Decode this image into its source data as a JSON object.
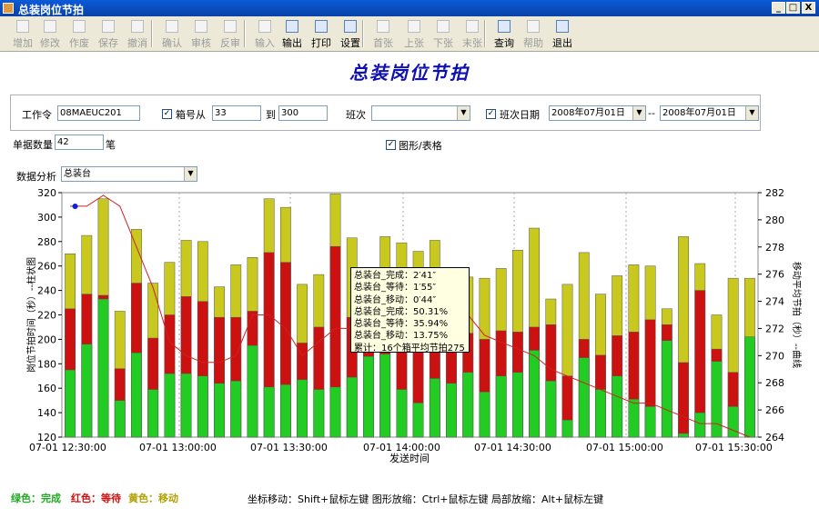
{
  "window": {
    "title": "总装岗位节拍",
    "min": "_",
    "max": "□",
    "close": "X"
  },
  "toolbar": [
    {
      "label": "增加",
      "icon": "add-icon",
      "enabled": false
    },
    {
      "label": "修改",
      "icon": "edit-icon",
      "enabled": false
    },
    {
      "label": "作废",
      "icon": "void-icon",
      "enabled": false
    },
    {
      "label": "保存",
      "icon": "save-icon",
      "enabled": false
    },
    {
      "label": "撤消",
      "icon": "undo-icon",
      "enabled": false
    },
    {
      "label": "确认",
      "icon": "confirm-icon",
      "enabled": false
    },
    {
      "label": "审核",
      "icon": "audit-icon",
      "enabled": false
    },
    {
      "label": "反审",
      "icon": "unaudit-icon",
      "enabled": false
    },
    {
      "label": "输入",
      "icon": "input-icon",
      "enabled": false
    },
    {
      "label": "输出",
      "icon": "export-icon",
      "enabled": true
    },
    {
      "label": "打印",
      "icon": "print-icon",
      "enabled": true
    },
    {
      "label": "设置",
      "icon": "setup-icon",
      "enabled": true
    },
    {
      "label": "首张",
      "icon": "first-icon",
      "enabled": false
    },
    {
      "label": "上张",
      "icon": "prev-icon",
      "enabled": false
    },
    {
      "label": "下张",
      "icon": "next-icon",
      "enabled": false
    },
    {
      "label": "末张",
      "icon": "last-icon",
      "enabled": false
    },
    {
      "label": "查询",
      "icon": "search-icon",
      "enabled": true
    },
    {
      "label": "帮助",
      "icon": "help-icon",
      "enabled": false
    },
    {
      "label": "退出",
      "icon": "exit-icon",
      "enabled": true
    }
  ],
  "page_title": "总装岗位节拍",
  "filters": {
    "work_order_label": "工作令",
    "work_order": "08MAEUC201",
    "box_from_label": "箱号从",
    "box_from": "33",
    "box_to_label": "到",
    "box_to": "300",
    "shift_label": "班次",
    "shift": "",
    "shift_date_label": "班次日期",
    "date_from": "2008年07月01日",
    "date_sep": "--",
    "date_to": "2008年07月01日",
    "count_label": "单据数量",
    "count": "42",
    "count_unit": "笔",
    "graph_table_label": "图形/表格",
    "analysis_label": "数据分析",
    "analysis": "总装台"
  },
  "chart_data": {
    "type": "bar",
    "ylabel": "岗位节拍时间（秒）--柱状图",
    "y2label": "移动平均节拍（秒）--曲线",
    "xlabel": "发送时间",
    "ylim": [
      120,
      320
    ],
    "y2lim": [
      264,
      282
    ],
    "yticks": [
      "120",
      "140",
      "160",
      "180",
      "200",
      "220",
      "240",
      "260",
      "280",
      "300",
      "320"
    ],
    "y2ticks": [
      "264",
      "266",
      "268",
      "270",
      "272",
      "274",
      "276",
      "278",
      "280",
      "282"
    ],
    "xticks": [
      "07-01 12:30:00",
      "07-01 13:00:00",
      "07-01 13:30:00",
      "07-01 14:00:00",
      "07-01 14:30:00",
      "07-01 15:00:00",
      "07-01 15:30:00"
    ],
    "series": [
      {
        "name": "完成",
        "color": "#22cc22",
        "values": [
          175,
          196,
          233,
          150,
          189,
          159,
          172,
          172,
          170,
          164,
          166,
          195,
          161,
          163,
          167,
          159,
          161,
          169,
          186,
          188,
          159,
          148,
          168,
          164,
          173,
          157,
          170,
          173,
          191,
          166,
          134,
          185,
          159,
          170,
          151,
          145,
          199,
          123,
          140,
          182,
          145,
          202
        ]
      },
      {
        "name": "等待",
        "color": "#cc1111",
        "values": [
          225,
          237,
          236,
          176,
          246,
          201,
          220,
          235,
          231,
          218,
          218,
          223,
          271,
          263,
          197,
          210,
          276,
          218,
          228,
          235,
          240,
          230,
          202,
          233,
          205,
          200,
          207,
          206,
          210,
          212,
          170,
          200,
          187,
          203,
          206,
          216,
          212,
          181,
          240,
          192,
          173,
          197
        ]
      },
      {
        "name": "移动",
        "color": "#c8c81e",
        "values": [
          270,
          285,
          315,
          223,
          290,
          246,
          263,
          281,
          280,
          243,
          261,
          267,
          315,
          308,
          245,
          253,
          319,
          283,
          258,
          284,
          279,
          272,
          281,
          243,
          251,
          250,
          258,
          273,
          291,
          233,
          245,
          271,
          237,
          252,
          261,
          260,
          225,
          284,
          262,
          220,
          250,
          250
        ]
      }
    ],
    "moving_average": {
      "name": "移动平均节拍",
      "color": "#cc2222",
      "values": [
        281,
        281,
        281.8,
        281,
        278,
        275,
        271,
        270,
        269.5,
        269.5,
        270,
        273,
        273,
        272,
        270,
        271,
        272,
        272,
        272.5,
        273,
        273.5,
        274,
        273,
        272,
        273,
        271.5,
        271,
        270.5,
        270,
        269,
        268.5,
        268,
        267.5,
        267,
        266.5,
        266.5,
        266,
        265.5,
        265,
        265,
        264.5,
        264
      ]
    },
    "marker": {
      "value": 281,
      "color": "#1020dd"
    }
  },
  "tooltip": [
    "总装台_完成：2′41″",
    "总装台_等待：1′55″",
    "总装台_移动：0′44″",
    "总装台_完成：50.31%",
    "总装台_等待：35.94%",
    "总装台_移动：13.75%",
    "累计：16个箱平均节拍275"
  ],
  "legend": {
    "green": "绿色：完成",
    "red": "红色：等待",
    "yellow": "黄色：移动"
  },
  "hints": "坐标移动：Shift+鼠标左键    图形放缩：Ctrl+鼠标左键    局部放缩：Alt+鼠标左键"
}
